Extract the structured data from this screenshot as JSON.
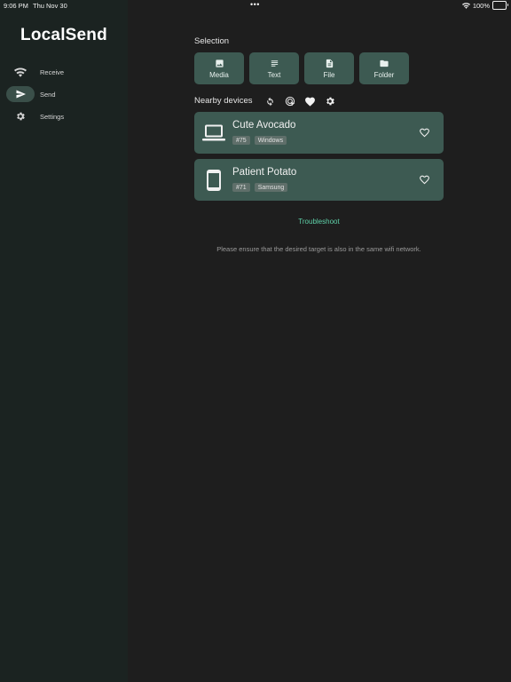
{
  "status_bar": {
    "time": "9:06 PM",
    "date": "Thu Nov 30",
    "dots": "•••",
    "battery": "100%"
  },
  "app": {
    "title": "LocalSend"
  },
  "nav": {
    "items": [
      {
        "label": "Receive",
        "icon": "wifi-icon"
      },
      {
        "label": "Send",
        "icon": "send-icon",
        "active": true
      },
      {
        "label": "Settings",
        "icon": "gear-icon"
      }
    ]
  },
  "selection": {
    "title": "Selection",
    "buttons": [
      {
        "label": "Media",
        "icon": "image-icon"
      },
      {
        "label": "Text",
        "icon": "text-lines-icon"
      },
      {
        "label": "File",
        "icon": "document-icon"
      },
      {
        "label": "Folder",
        "icon": "folder-icon"
      }
    ]
  },
  "nearby": {
    "title": "Nearby devices",
    "actions": [
      "refresh-icon",
      "scan-icon",
      "heart-icon",
      "gear-icon"
    ],
    "devices": [
      {
        "name": "Cute Avocado",
        "id": "#75",
        "platform": "Windows",
        "type": "laptop-icon"
      },
      {
        "name": "Patient Potato",
        "id": "#71",
        "platform": "Samsung",
        "type": "phone-icon"
      }
    ]
  },
  "troubleshoot": "Troubleshoot",
  "hint": "Please ensure that the desired target is also in the same wifi network.",
  "colors": {
    "sidebar_bg": "#1b2321",
    "main_bg": "#1e1e1e",
    "card_bg": "#3d5a52",
    "accent": "#5fd1a9"
  }
}
